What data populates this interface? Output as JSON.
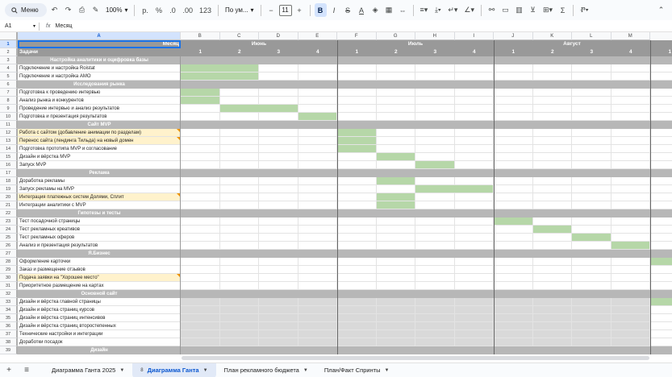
{
  "toolbar": {
    "menu_label": "Меню",
    "zoom": "100%",
    "currency": "р.",
    "percent": "%",
    "dec_less": ".0",
    "dec_more": ".00",
    "number_format": "123",
    "font": "По ум...",
    "font_size": "11",
    "minus": "−",
    "plus": "+",
    "bold": "B",
    "italic": "I",
    "strike": "S",
    "text_color": "A"
  },
  "formula_bar": {
    "cell_ref": "A1",
    "fx": "fx",
    "value": "Месяц"
  },
  "columns": [
    "A",
    "B",
    "C",
    "D",
    "E",
    "F",
    "G",
    "H",
    "I",
    "J",
    "K",
    "L",
    "M"
  ],
  "header": {
    "month_label": "Месяц",
    "tasks_label": "Задачи",
    "months": [
      "Июнь",
      "Июль",
      "Август"
    ],
    "weeks": [
      "1",
      "2",
      "3",
      "4",
      "1",
      "2",
      "3",
      "4",
      "1",
      "2",
      "3",
      "4",
      "1"
    ]
  },
  "rows": [
    {
      "n": "3",
      "type": "section",
      "text": "Настройка аналитики и оцифровка базы"
    },
    {
      "n": "4",
      "type": "task",
      "text": "Подключение и настройка Roistat",
      "bar": [
        0,
        2
      ]
    },
    {
      "n": "5",
      "type": "task",
      "text": "Подключение и настройка АМО",
      "bar": [
        0,
        2
      ]
    },
    {
      "n": "6",
      "type": "section",
      "text": "Исследования рынка"
    },
    {
      "n": "7",
      "type": "task",
      "text": "Подготовка к проведению интервью",
      "bar": [
        0,
        1
      ]
    },
    {
      "n": "8",
      "type": "task",
      "text": "Анализ рынка и конкурентов",
      "bar": [
        0,
        1
      ]
    },
    {
      "n": "9",
      "type": "task",
      "text": "Проведение интервью и анализ результатов",
      "bar": [
        1,
        3
      ]
    },
    {
      "n": "10",
      "type": "task",
      "text": "Подготовка и презентация результатов",
      "bar": [
        3,
        4
      ]
    },
    {
      "n": "11",
      "type": "section",
      "text": "Сайт MVP"
    },
    {
      "n": "12",
      "type": "task",
      "text": "Работа с сайтом (добавление анимации по разделам)",
      "yellow": true,
      "bar": [
        4,
        5
      ]
    },
    {
      "n": "13",
      "type": "task",
      "text": "Перенос сайта (лендинга Тильда) на новый домен",
      "yellow": true,
      "bar": [
        4,
        5
      ]
    },
    {
      "n": "14",
      "type": "task",
      "text": "Подготовка прототипа MVP и согласование",
      "bar": [
        4,
        5
      ]
    },
    {
      "n": "15",
      "type": "task",
      "text": "Дизайн и вёрстка MVP",
      "bar": [
        5,
        6
      ]
    },
    {
      "n": "16",
      "type": "task",
      "text": "Запуск MVP",
      "bar": [
        6,
        7
      ]
    },
    {
      "n": "17",
      "type": "section",
      "text": "Реклама"
    },
    {
      "n": "18",
      "type": "task",
      "text": "Доработка рекламы",
      "bar": [
        5,
        6
      ]
    },
    {
      "n": "19",
      "type": "task",
      "text": "Запуск рекламы на MVP",
      "bar": [
        6,
        8
      ]
    },
    {
      "n": "20",
      "type": "task",
      "text": "Интеграция платежных систем Долями, Сплит",
      "yellow": true,
      "bar": [
        5,
        6
      ]
    },
    {
      "n": "21",
      "type": "task",
      "text": "Интеграции аналитики с MVP",
      "bar": [
        5,
        6
      ]
    },
    {
      "n": "22",
      "type": "section",
      "text": "Гипотезы и тесты"
    },
    {
      "n": "23",
      "type": "task",
      "text": "Тест посадочной страницы",
      "bar": [
        8,
        9
      ]
    },
    {
      "n": "24",
      "type": "task",
      "text": "Тест рекламных креативов",
      "bar": [
        9,
        10
      ]
    },
    {
      "n": "25",
      "type": "task",
      "text": "Тест рекламных оферов",
      "bar": [
        10,
        11
      ]
    },
    {
      "n": "26",
      "type": "task",
      "text": "Анализ и презентация результатов",
      "bar": [
        11,
        12
      ]
    },
    {
      "n": "27",
      "type": "section",
      "text": "Я.Бизнес"
    },
    {
      "n": "28",
      "type": "task",
      "text": "Оформление карточки",
      "bar": [
        12,
        13
      ]
    },
    {
      "n": "29",
      "type": "task",
      "text": "Заказ и размещение отзывов"
    },
    {
      "n": "30",
      "type": "task",
      "text": "Подача заявки на \"Хорошее место\"",
      "yellow": true
    },
    {
      "n": "31",
      "type": "task",
      "text": "Приоритетное размещение на картах"
    },
    {
      "n": "32",
      "type": "section",
      "text": "Основной сайт"
    },
    {
      "n": "33",
      "type": "task",
      "text": "Дизайн и вёрстка главной страницы",
      "shade": true,
      "bar": [
        12,
        13
      ]
    },
    {
      "n": "34",
      "type": "task",
      "text": "Дизайн и вёрстка страниц курсов",
      "shade": true
    },
    {
      "n": "35",
      "type": "task",
      "text": "Дизайн и вёрстка страниц интенсивов",
      "shade": true
    },
    {
      "n": "36",
      "type": "task",
      "text": "Дизайн и вёрстка страниц второстепенных",
      "shade": true
    },
    {
      "n": "37",
      "type": "task",
      "text": "Технические настройки и интеграции",
      "shade": true
    },
    {
      "n": "38",
      "type": "task",
      "text": "Доработки посадок",
      "shade": true
    },
    {
      "n": "39",
      "type": "section",
      "text": "Дизайн"
    }
  ],
  "tabs": {
    "add": "+",
    "all": "≡",
    "items": [
      {
        "label": "Диаграмма Ганта 2025",
        "active": false
      },
      {
        "label": "Диаграмма Ганта",
        "active": true,
        "num": "8"
      },
      {
        "label": "План рекламного бюджета",
        "active": false
      },
      {
        "label": "План/Факт Спринты",
        "active": false
      }
    ]
  },
  "colors": {
    "gantt": "#b6d7a8",
    "section": "#b7b7b7",
    "header": "#999999",
    "highlight": "#fff2cc",
    "shade": "#d9d9d9"
  }
}
